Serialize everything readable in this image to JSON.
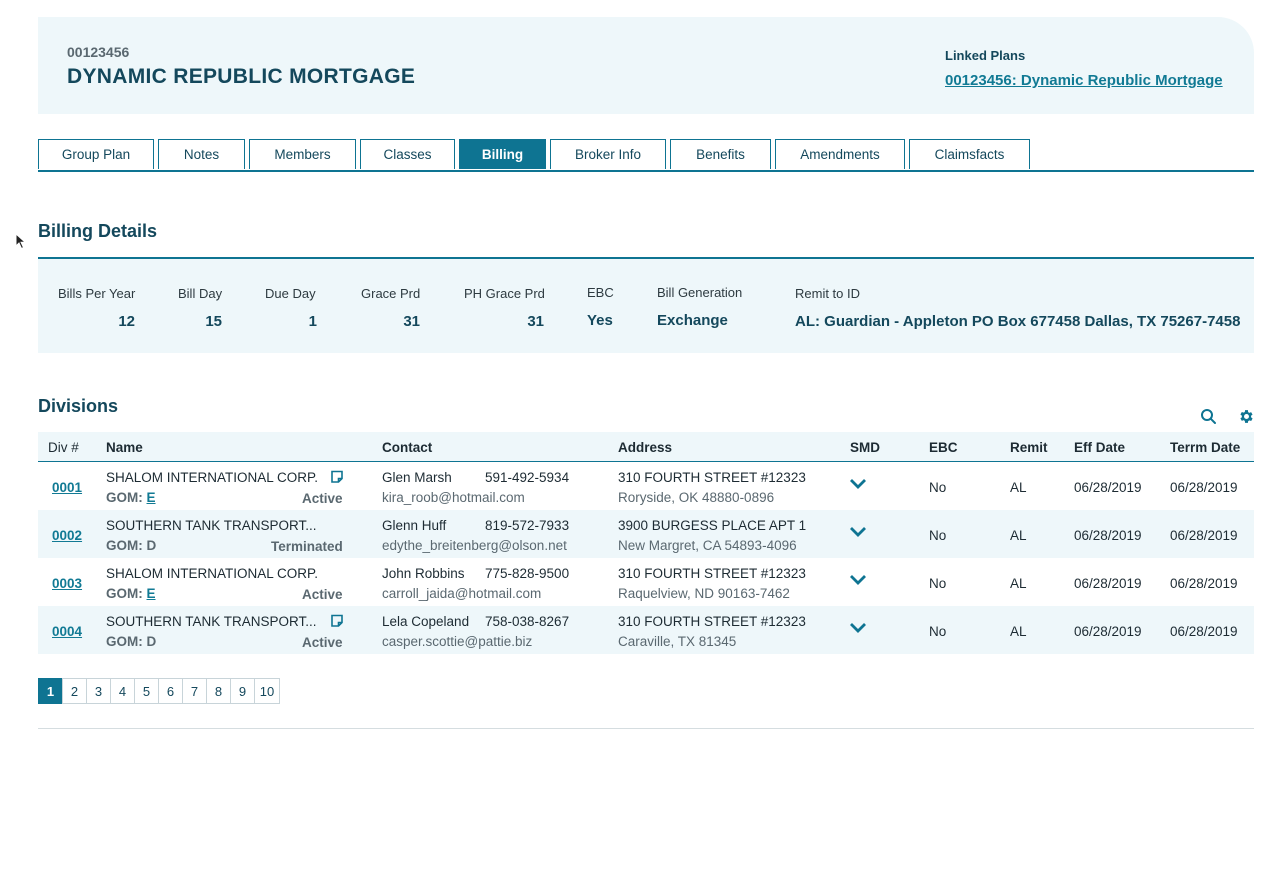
{
  "header": {
    "plan_number": "00123456",
    "plan_name": "DYNAMIC REPUBLIC MORTGAGE",
    "linked_plans_label": "Linked Plans",
    "linked_plan_link": "00123456: Dynamic Republic Mortgage"
  },
  "tabs": [
    {
      "label": "Group Plan"
    },
    {
      "label": "Notes"
    },
    {
      "label": "Members"
    },
    {
      "label": "Classes"
    },
    {
      "label": "Billing",
      "active": true
    },
    {
      "label": "Broker Info"
    },
    {
      "label": "Benefits"
    },
    {
      "label": "Amendments"
    },
    {
      "label": "Claimsfacts"
    }
  ],
  "billing": {
    "title": "Billing Details",
    "fields": [
      {
        "label": "Bills Per Year",
        "value": "12"
      },
      {
        "label": "Bill Day",
        "value": "15"
      },
      {
        "label": "Due Day",
        "value": "1"
      },
      {
        "label": "Grace Prd",
        "value": "31"
      },
      {
        "label": "PH Grace Prd",
        "value": "31"
      },
      {
        "label": "EBC",
        "value": "Yes"
      },
      {
        "label": "Bill Generation",
        "value": "Exchange"
      },
      {
        "label": "Remit to ID",
        "value": "AL: Guardian - Appleton PO Box 677458 Dallas, TX 75267-7458"
      }
    ]
  },
  "divisions": {
    "title": "Divisions",
    "columns": [
      "Div #",
      "Name",
      "Contact",
      "Address",
      "SMD",
      "EBC",
      "Remit",
      "Eff Date",
      "Terrm Date"
    ],
    "gom_label": "GOM:",
    "rows": [
      {
        "div": "0001",
        "name": "SHALOM INTERNATIONAL CORP.",
        "has_note": true,
        "gom": "E",
        "gom_link": true,
        "status": "Active",
        "contact": "Glen Marsh",
        "phone": "591-492-5934",
        "email": "kira_roob@hotmail.com",
        "address1": "310 FOURTH STREET #12323",
        "address2": "Roryside, OK 48880-0896",
        "ebc": "No",
        "remit": "AL",
        "eff": "06/28/2019",
        "term": "06/28/2019"
      },
      {
        "div": "0002",
        "name": "SOUTHERN TANK TRANSPORT...",
        "has_note": false,
        "gom": "D",
        "gom_link": false,
        "status": "Terminated",
        "contact": "Glenn Huff",
        "phone": "819-572-7933",
        "email": "edythe_breitenberg@olson.net",
        "address1": "3900 BURGESS PLACE APT 1",
        "address2": "New Margret, CA 54893-4096",
        "ebc": "No",
        "remit": "AL",
        "eff": "06/28/2019",
        "term": "06/28/2019"
      },
      {
        "div": "0003",
        "name": "SHALOM INTERNATIONAL CORP.",
        "has_note": false,
        "gom": "E",
        "gom_link": true,
        "status": "Active",
        "contact": "John Robbins",
        "phone": "775-828-9500",
        "email": "carroll_jaida@hotmail.com",
        "address1": "310 FOURTH STREET #12323",
        "address2": "Raquelview, ND 90163-7462",
        "ebc": "No",
        "remit": "AL",
        "eff": "06/28/2019",
        "term": "06/28/2019"
      },
      {
        "div": "0004",
        "name": "SOUTHERN TANK TRANSPORT...",
        "has_note": true,
        "gom": "D",
        "gom_link": false,
        "status": "Active",
        "contact": "Lela Copeland",
        "phone": "758-038-8267",
        "email": "casper.scottie@pattie.biz",
        "address1": "310 FOURTH STREET #12323",
        "address2": "Caraville, TX 81345",
        "ebc": "No",
        "remit": "AL",
        "eff": "06/28/2019",
        "term": "06/28/2019"
      }
    ]
  },
  "pagination": {
    "pages": [
      "1",
      "2",
      "3",
      "4",
      "5",
      "6",
      "7",
      "8",
      "9",
      "10"
    ],
    "current": "1"
  },
  "colors": {
    "accent": "#0e7492",
    "heading": "#14485c",
    "panel": "#eef7fa"
  },
  "icons": {
    "search": "search-icon",
    "settings": "gear-icon",
    "smd": "chevron-down-icon",
    "note": "note-icon"
  }
}
